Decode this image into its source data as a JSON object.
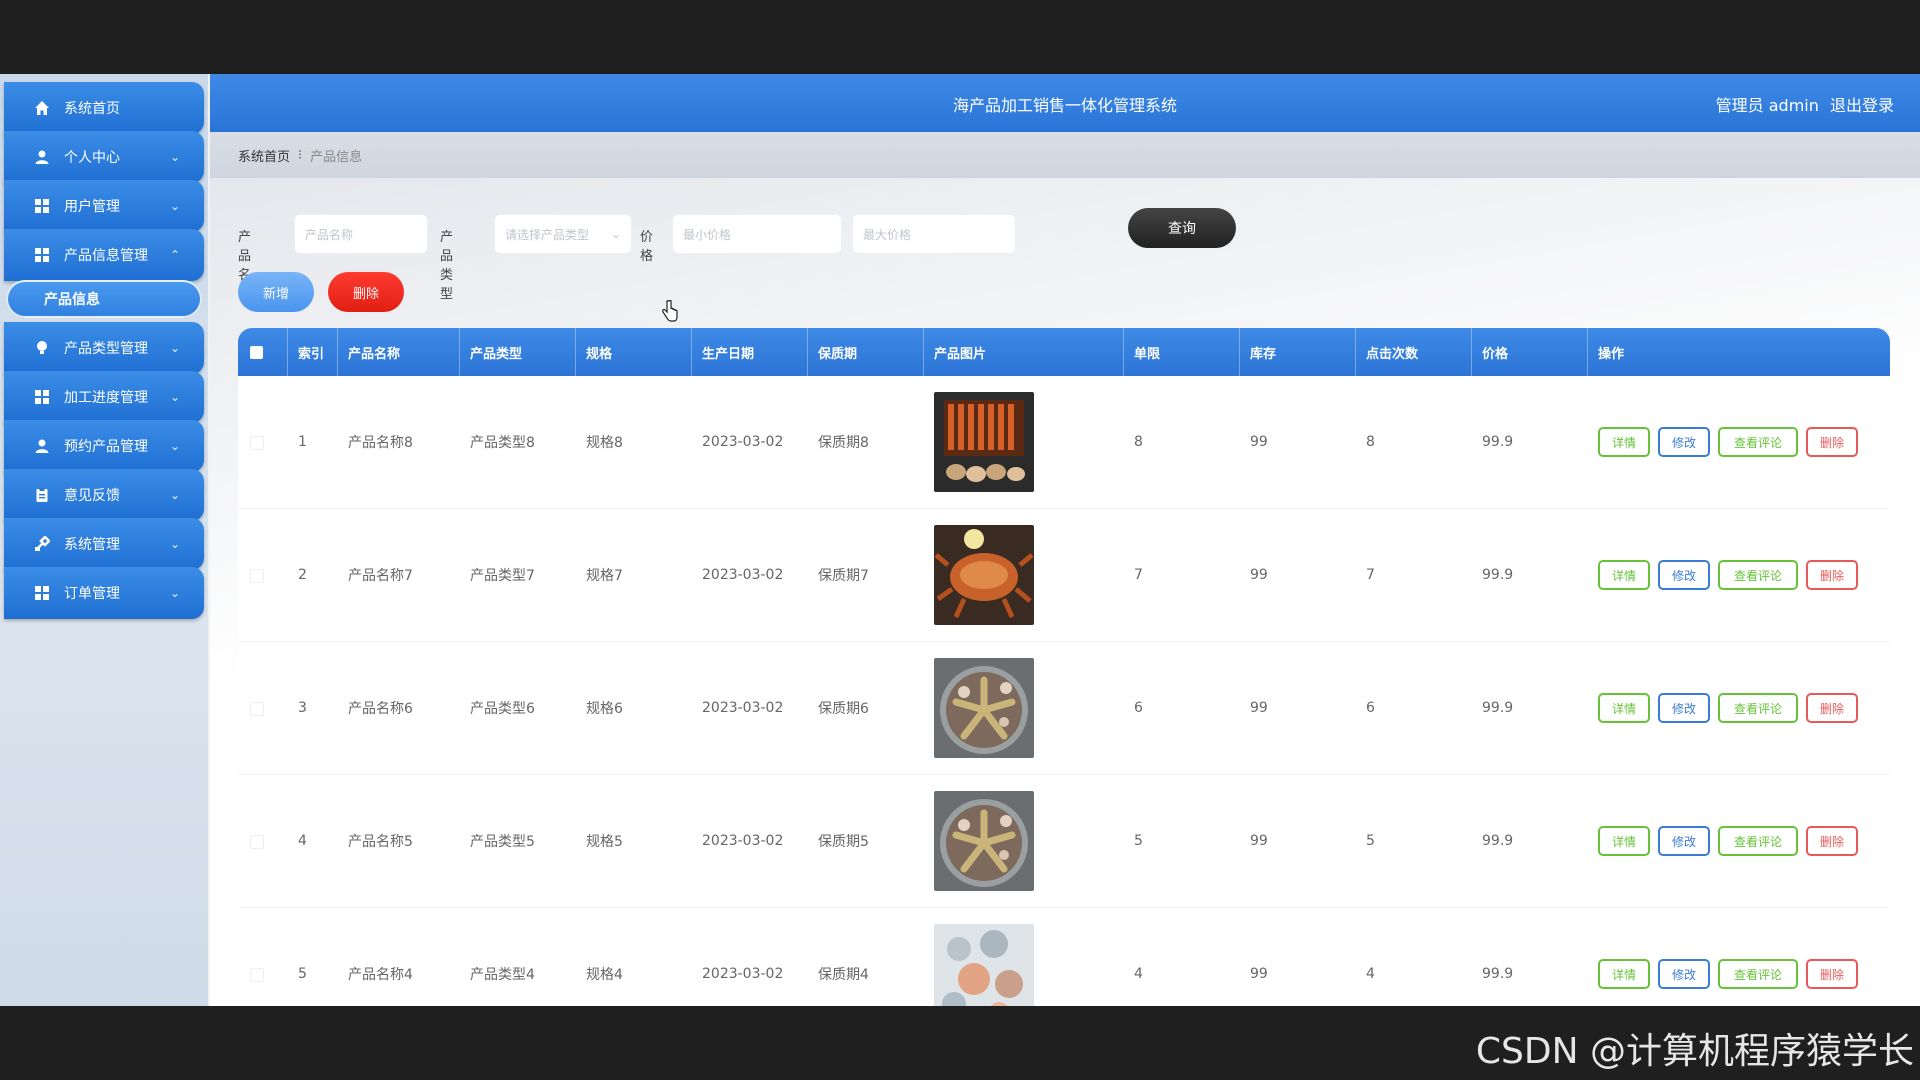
{
  "header": {
    "title": "海产品加工销售一体化管理系统",
    "role": "管理员 admin",
    "logout": "退出登录"
  },
  "sidebar": {
    "items": [
      {
        "label": "系统首页",
        "icon": "home-icon",
        "arrow": ""
      },
      {
        "label": "个人中心",
        "icon": "user-icon",
        "arrow": "⌄"
      },
      {
        "label": "用户管理",
        "icon": "grid-icon",
        "arrow": "⌄"
      },
      {
        "label": "产品信息管理",
        "icon": "grid-icon",
        "arrow": "⌃"
      },
      {
        "label": "产品类型管理",
        "icon": "bulb-icon",
        "arrow": "⌄"
      },
      {
        "label": "加工进度管理",
        "icon": "grid-icon",
        "arrow": "⌄"
      },
      {
        "label": "预约产品管理",
        "icon": "user-icon",
        "arrow": "⌄"
      },
      {
        "label": "意见反馈",
        "icon": "clipboard-icon",
        "arrow": "⌄"
      },
      {
        "label": "系统管理",
        "icon": "tools-icon",
        "arrow": "⌄"
      },
      {
        "label": "订单管理",
        "icon": "grid-icon",
        "arrow": "⌄"
      }
    ],
    "sub_item": "产品信息"
  },
  "breadcrumb": {
    "home": "系统首页",
    "sep": "⁝",
    "current": "产品信息"
  },
  "filters": {
    "name_label": "产品名称",
    "name_placeholder": "产品名称",
    "type_label": "产品类型",
    "type_placeholder": "请选择产品类型",
    "price_label": "价格",
    "min_placeholder": "最小价格",
    "max_placeholder": "最大价格",
    "query": "查询"
  },
  "actions": {
    "add": "新增",
    "delete": "删除"
  },
  "table": {
    "headers": [
      "索引",
      "产品名称",
      "产品类型",
      "规格",
      "生产日期",
      "保质期",
      "产品图片",
      "单限",
      "库存",
      "点击次数",
      "价格",
      "操作"
    ],
    "ops": {
      "detail": "详情",
      "edit": "修改",
      "review": "查看评论",
      "delete": "删除"
    },
    "rows": [
      {
        "index": "1",
        "name": "产品名称8",
        "type": "产品类型8",
        "spec": "规格8",
        "date": "2023-03-02",
        "shelf": "保质期8",
        "limit": "8",
        "stock": "99",
        "clicks": "8",
        "price": "99.9"
      },
      {
        "index": "2",
        "name": "产品名称7",
        "type": "产品类型7",
        "spec": "规格7",
        "date": "2023-03-02",
        "shelf": "保质期7",
        "limit": "7",
        "stock": "99",
        "clicks": "7",
        "price": "99.9"
      },
      {
        "index": "3",
        "name": "产品名称6",
        "type": "产品类型6",
        "spec": "规格6",
        "date": "2023-03-02",
        "shelf": "保质期6",
        "limit": "6",
        "stock": "99",
        "clicks": "6",
        "price": "99.9"
      },
      {
        "index": "4",
        "name": "产品名称5",
        "type": "产品类型5",
        "spec": "规格5",
        "date": "2023-03-02",
        "shelf": "保质期5",
        "limit": "5",
        "stock": "99",
        "clicks": "5",
        "price": "99.9"
      },
      {
        "index": "5",
        "name": "产品名称4",
        "type": "产品类型4",
        "spec": "规格4",
        "date": "2023-03-02",
        "shelf": "保质期4",
        "limit": "4",
        "stock": "99",
        "clicks": "4",
        "price": "99.9"
      }
    ]
  },
  "watermark": "CSDN @计算机程序猿学长",
  "colors": {
    "primary": "#2c74d6",
    "danger": "#e01f12",
    "success": "#67c23a",
    "dark": "#222222"
  }
}
